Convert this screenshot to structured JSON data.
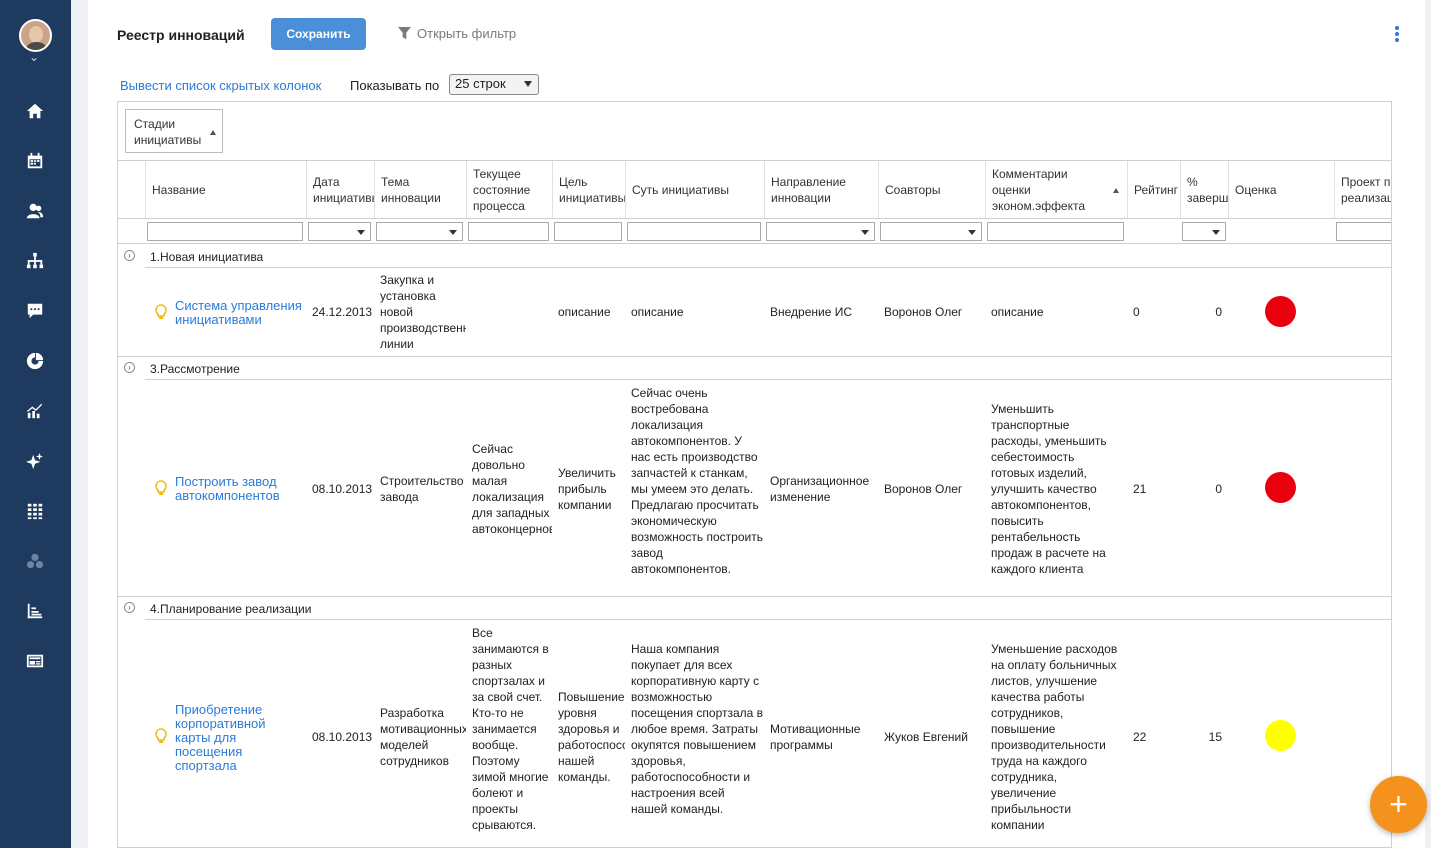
{
  "sidebar": {
    "icons": [
      "home-icon",
      "calendar-icon",
      "users-icon",
      "org-chart-icon",
      "chat-icon",
      "pie-chart-icon",
      "trend-chart-icon",
      "sparkle-icon",
      "grid-icon",
      "network-icon",
      "bar-chart-icon",
      "news-icon"
    ]
  },
  "header": {
    "title": "Реестр инноваций",
    "save_label": "Сохранить",
    "filter_label": "Открыть фильтр"
  },
  "toolbar": {
    "hidden_columns_link": "Вывести список скрытых колонок",
    "rows_label": "Показывать по",
    "rows_value": "25 строк"
  },
  "grouping": {
    "label": "Стадии\nинициативы"
  },
  "columns": {
    "name": "Название",
    "date": "Дата\nинициативы",
    "topic": "Тема\nинновации",
    "state": "Текущее\nсостояние\nпроцесса",
    "goal": "Цель\nинициативы",
    "essence": "Суть инициативы",
    "direction": "Направление\nинновации",
    "coauthors": "Соавторы",
    "comments": "Комментарии\nоценки\nэконом.эффекта",
    "rating": "Рейтинг",
    "percent": "%\nзавершения",
    "score": "Оценка",
    "project": "Проект по\nреализации"
  },
  "groups": [
    {
      "label": "1.Новая инициатива",
      "row": {
        "name": "Система управления инициативами",
        "date": "24.12.2013",
        "topic": "Закупка и установка новой производственной линии",
        "state": "",
        "goal": "описание",
        "essence": "описание",
        "direction": "Внедрение ИС",
        "coauthors": "Воронов Олег",
        "comments": "описание",
        "rating": "0",
        "percent": "0",
        "score_color": "#e8000f"
      }
    },
    {
      "label": "3.Рассмотрение",
      "row": {
        "name": "Построить завод автокомпонентов",
        "date": "08.10.2013",
        "topic": "Строительство завода",
        "state": "Сейчас довольно малая локализация для западных автоконцернов",
        "goal": "Увеличить прибыль компании",
        "essence": "Сейчас очень востребована локализация автокомпонентов. У нас есть производство запчастей к станкам, мы умеем это делать. Предлагаю просчитать экономическую возможность построить завод автокомпонентов.",
        "direction": "Организационное изменение",
        "coauthors": "Воронов Олег",
        "comments": "Уменьшить транспортные расходы, уменьшить себестоимость готовых изделий, улучшить качество автокомпонентов, повысить рентабельность продаж в расчете на каждого клиента",
        "rating": "21",
        "percent": "0",
        "score_color": "#e8000f"
      }
    },
    {
      "label": "4.Планирование реализации",
      "row": {
        "name": "Приобретение корпоративной карты для посещения спортзала",
        "date": "08.10.2013",
        "topic": "Разработка мотивационных моделей сотрудников",
        "state": "Все занимаются в разных спортзалах и за свой счет. Кто-то не занимается вообще. Поэтому зимой многие болеют и проекты срываются.",
        "goal": "Повышение уровня здоровья и работоспособности нашей команды.",
        "essence": "Наша компания покупает для всех корпоративную карту с возможностью посещения спортзала в любое время. Затраты окупятся повышением здоровья, работоспособности и настроения всей нашей команды.",
        "direction": "Мотивационные программы",
        "coauthors": "Жуков Евгений",
        "comments": "Уменьшение расходов на оплату больничных листов, улучшение качества работы сотрудников, повышение производительности труда на каждого сотрудника, увеличение прибыльности компании",
        "rating": "22",
        "percent": "15",
        "score_color": "#ffff00"
      }
    }
  ],
  "fab": {
    "label": "+"
  }
}
